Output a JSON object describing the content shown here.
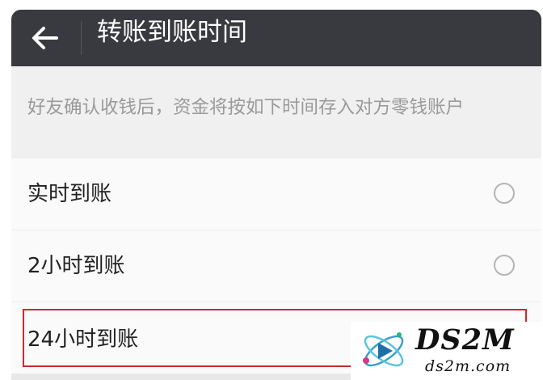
{
  "header": {
    "back_icon": "arrow-left-icon",
    "title": "转账到账时间"
  },
  "description": "好友确认收钱后，资金将按如下时间存入对方零钱账户",
  "options": [
    {
      "label": "实时到账",
      "selected": false
    },
    {
      "label": "2小时到账",
      "selected": false
    },
    {
      "label": "24小时到账",
      "selected": false,
      "highlighted": true
    }
  ],
  "watermark": {
    "brand": "DS2M",
    "url": "ds2m.com"
  },
  "colors": {
    "header_bg": "#393a3f",
    "page_bg": "#f0f0f0",
    "option_bg": "#fafafa",
    "highlight_border": "#d3282d"
  }
}
